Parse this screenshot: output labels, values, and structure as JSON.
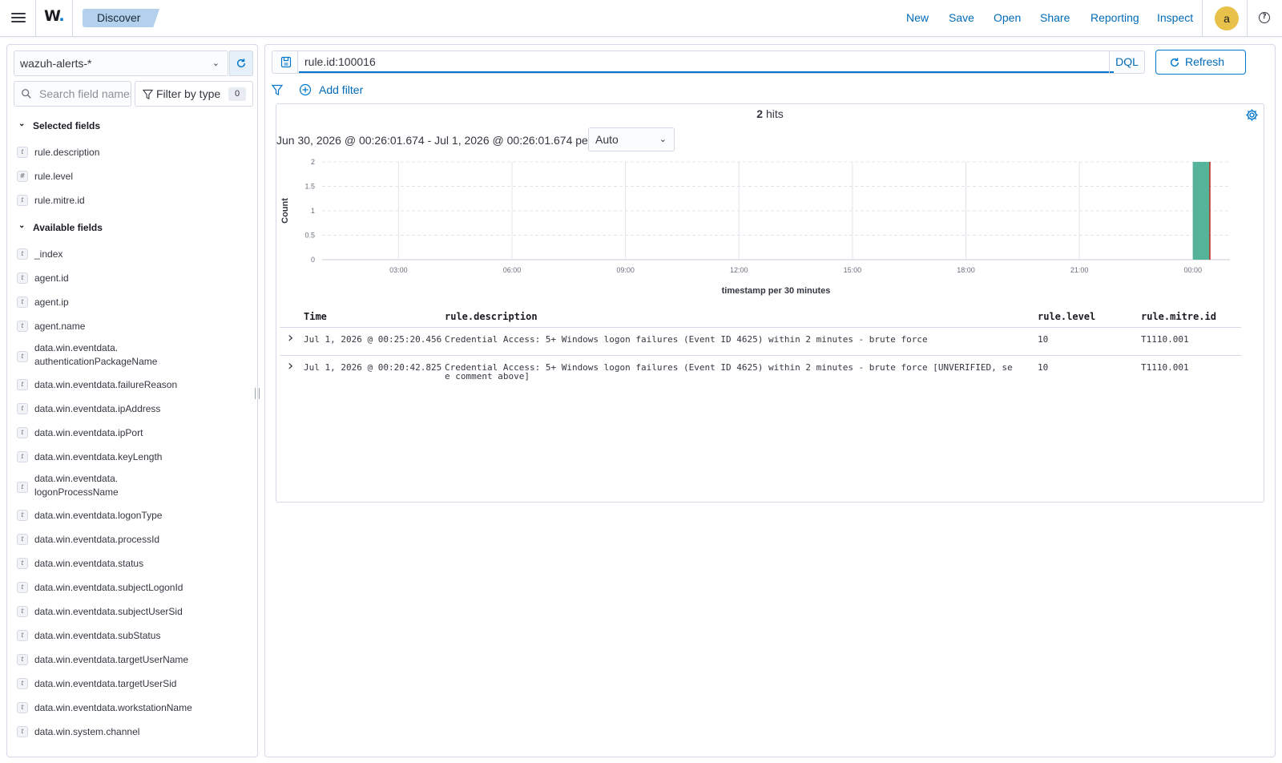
{
  "header": {
    "brand": "W",
    "brand_dot": ".",
    "breadcrumb": "Discover",
    "nav": [
      "New",
      "Save",
      "Open",
      "Share",
      "Reporting",
      "Inspect"
    ],
    "avatar_initial": "a",
    "help_glyph": "?",
    "brand_color": "#0077cc"
  },
  "sidebar": {
    "index_pattern": "wazuh-alerts-*",
    "search_placeholder": "Search field names",
    "filter_by_type_label": "Filter by type",
    "filter_count": "0",
    "selected_fields_title": "Selected fields",
    "selected_fields": [
      {
        "name": "rule.description",
        "type": "t"
      },
      {
        "name": "rule.level",
        "type": "#"
      },
      {
        "name": "rule.mitre.id",
        "type": "t"
      }
    ],
    "available_fields_title": "Available fields",
    "available_fields": [
      {
        "name": "_index",
        "type": "t"
      },
      {
        "name": "agent.id",
        "type": "t"
      },
      {
        "name": "agent.ip",
        "type": "t"
      },
      {
        "name": "agent.name",
        "type": "t"
      },
      {
        "name": "data.win.eventdata.\nauthenticationPackageName",
        "type": "t"
      },
      {
        "name": "data.win.eventdata.failureReason",
        "type": "t"
      },
      {
        "name": "data.win.eventdata.ipAddress",
        "type": "t"
      },
      {
        "name": "data.win.eventdata.ipPort",
        "type": "t"
      },
      {
        "name": "data.win.eventdata.keyLength",
        "type": "t"
      },
      {
        "name": "data.win.eventdata.\nlogonProcessName",
        "type": "t"
      },
      {
        "name": "data.win.eventdata.logonType",
        "type": "t"
      },
      {
        "name": "data.win.eventdata.processId",
        "type": "t"
      },
      {
        "name": "data.win.eventdata.status",
        "type": "t"
      },
      {
        "name": "data.win.eventdata.subjectLogonId",
        "type": "t"
      },
      {
        "name": "data.win.eventdata.subjectUserSid",
        "type": "t"
      },
      {
        "name": "data.win.eventdata.subStatus",
        "type": "t"
      },
      {
        "name": "data.win.eventdata.targetUserName",
        "type": "t"
      },
      {
        "name": "data.win.eventdata.targetUserSid",
        "type": "t"
      },
      {
        "name": "data.win.eventdata.workstationName",
        "type": "t"
      },
      {
        "name": "data.win.system.channel",
        "type": "t"
      }
    ]
  },
  "query": {
    "value": "rule.id:100016",
    "language": "DQL",
    "refresh_label": "Refresh",
    "add_filter_label": "Add filter"
  },
  "results": {
    "hits_count": "2",
    "hits_label": "hits",
    "time_range": "Jun 30, 2026 @ 00:26:01.674 - Jul 1, 2026 @ 00:26:01.674 per",
    "interval": "Auto"
  },
  "chart_data": {
    "type": "bar",
    "xlabel": "timestamp per 30 minutes",
    "ylabel": "Count",
    "x_ticks": [
      "03:00",
      "06:00",
      "09:00",
      "12:00",
      "15:00",
      "18:00",
      "21:00",
      "00:00"
    ],
    "y_ticks": [
      "0",
      "0.5",
      "1",
      "1.5",
      "2"
    ],
    "ylim": [
      0,
      2
    ],
    "bars": [
      {
        "x": "00:00",
        "value": 2
      }
    ],
    "bar_color": "#54b399",
    "grid": true
  },
  "table": {
    "columns": [
      "Time",
      "rule.description",
      "rule.level",
      "rule.mitre.id"
    ],
    "rows": [
      {
        "time": "Jul 1, 2026 @ 00:25:20.456",
        "description": "Credential Access: 5+ Windows logon failures (Event ID 4625) within 2 minutes - brute force",
        "level": "10",
        "mitre": "T1110.001"
      },
      {
        "time": "Jul 1, 2026 @ 00:20:42.825",
        "description": "Credential Access: 5+ Windows logon failures (Event ID 4625) within 2 minutes - brute force [UNVERIFIED, se\ne comment above]",
        "level": "10",
        "mitre": "T1110.001"
      }
    ]
  }
}
